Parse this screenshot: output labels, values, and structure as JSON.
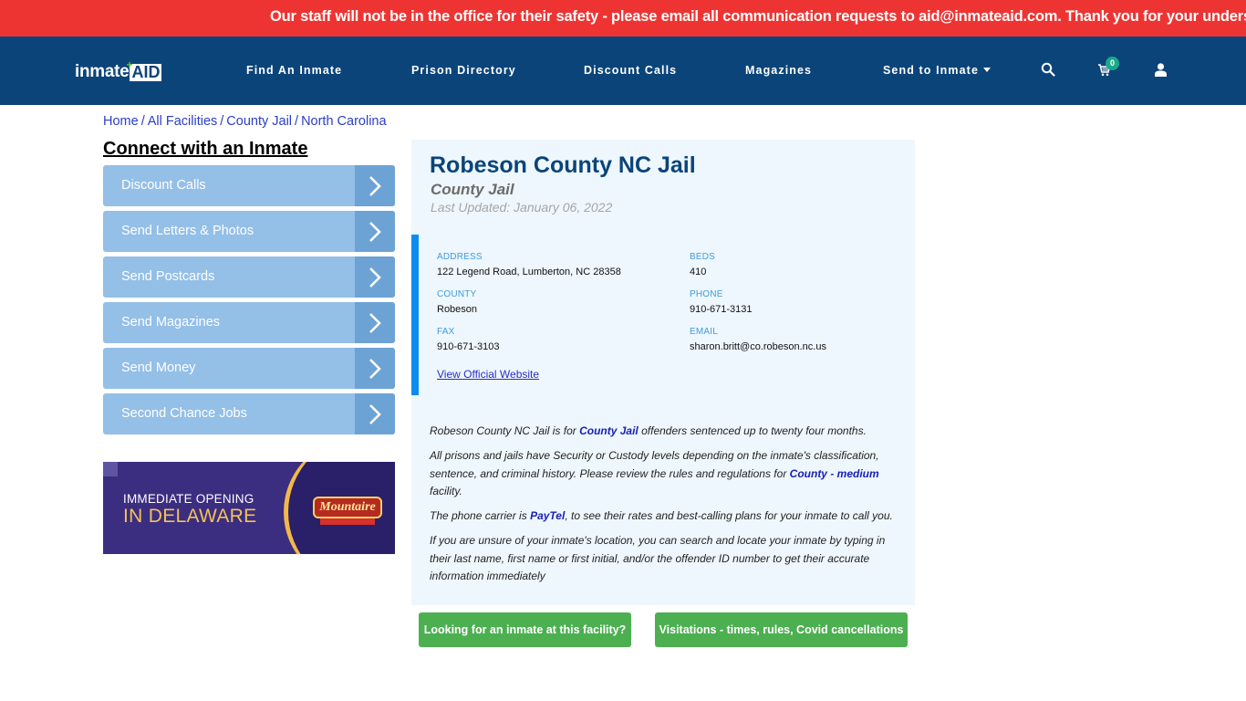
{
  "alert": {
    "text": "Our staff will not be in the office for their safety - please email all communication requests to aid@inmateaid.com. Thank you for your understanding."
  },
  "colors": {
    "alert_bg": "#ee3432",
    "navbar_bg": "#0b4479",
    "accent_blue": "#0e8bee",
    "sidebar_button": "#94bfe7",
    "green_button": "#4caf50",
    "cart_badge": "#1aa88b"
  },
  "navbar": {
    "logo": {
      "part1": "inmate",
      "part2": "AID",
      "plus": "+"
    },
    "items": [
      {
        "label": "Find An Inmate"
      },
      {
        "label": "Prison Directory"
      },
      {
        "label": "Discount Calls"
      },
      {
        "label": "Magazines"
      },
      {
        "label": "Send to Inmate"
      }
    ],
    "icons": {
      "search": "search-icon",
      "cart": "cart-icon",
      "user": "user-icon"
    },
    "cart_count": "0"
  },
  "breadcrumb": [
    {
      "label": "Home"
    },
    {
      "label": "All Facilities"
    },
    {
      "label": "County Jail"
    },
    {
      "label": "North Carolina"
    }
  ],
  "breadcrumb_separator": "/",
  "sidebar": {
    "title": "Connect with an Inmate",
    "buttons": [
      {
        "label": "Discount Calls"
      },
      {
        "label": "Send Letters & Photos"
      },
      {
        "label": "Send Postcards"
      },
      {
        "label": "Send Magazines"
      },
      {
        "label": "Send Money"
      },
      {
        "label": "Second Chance Jobs"
      }
    ],
    "ad": {
      "line1": "IMMEDIATE OPENING",
      "line2": "IN DELAWARE",
      "brand": "Mountaire"
    }
  },
  "facility": {
    "name": "Robeson County NC Jail",
    "type": "County Jail",
    "last_updated": "Last Updated: January 06, 2022",
    "info": {
      "address_label": "ADDRESS",
      "address": "122 Legend Road, Lumberton, NC 28358",
      "beds_label": "BEDS",
      "beds": "410",
      "county_label": "COUNTY",
      "county": "Robeson",
      "phone_label": "PHONE",
      "phone": "910-671-3131",
      "fax_label": "FAX",
      "fax": "910-671-3103",
      "email_label": "EMAIL",
      "email": "sharon.britt@co.robeson.nc.us",
      "website_link": "View Official Website"
    },
    "description": {
      "p1_a": "Robeson County NC Jail is for ",
      "p1_link": "County Jail",
      "p1_b": " offenders sentenced up to twenty four months.",
      "p2_a": "All prisons and jails have Security or Custody levels depending on the inmate's classification, sentence, and criminal history. Please review the rules and regulations for ",
      "p2_link": "County - medium",
      "p2_b": " facility.",
      "p3_a": "The phone carrier is ",
      "p3_link": "PayTel",
      "p3_b": ", to see their rates and best-calling plans for your inmate to call you.",
      "p4": "If you are unsure of your inmate's location, you can search and locate your inmate by typing in their last name, first name or first initial, and/or the offender ID number to get their accurate information immediately"
    }
  },
  "actions": {
    "find_inmate": "Looking for an inmate at this facility?",
    "visitations": "Visitations - times, rules, Covid cancellations"
  }
}
